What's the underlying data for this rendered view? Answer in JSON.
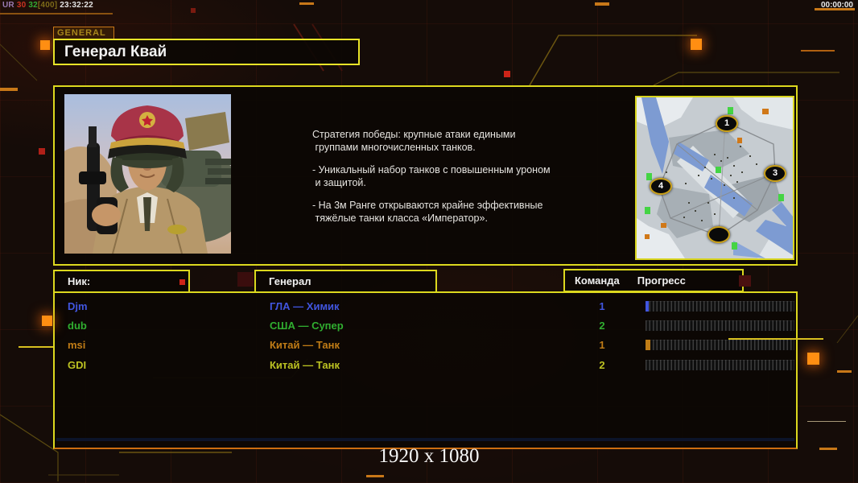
{
  "debug": {
    "tag": "UR",
    "val1": "30",
    "val2": "32",
    "val3": "[400]",
    "clock": "23:32:22"
  },
  "timer": "00:00:00",
  "header": {
    "tab": "GENERAL",
    "title": "Генерал Квай"
  },
  "strategy": {
    "lines": [
      "Стратегия победы: крупные атаки едиными",
      " группами многочисленных танков.",
      "- Уникальный набор танков с повышенным уроном",
      " и защитой.",
      "- На 3м Ранге открываются крайне эффективные",
      " тяжёлые танки класса «Император»."
    ]
  },
  "map": {
    "markers": [
      {
        "label": "1"
      },
      {
        "label": "3"
      },
      {
        "label": "4"
      },
      {
        "label": ""
      }
    ]
  },
  "table": {
    "headers": {
      "nick": "Ник:",
      "general": "Генерал",
      "team": "Команда",
      "progress": "Прогресс"
    }
  },
  "players": [
    {
      "nick": "Djm",
      "general": "ГЛА — Химик",
      "team": "1",
      "color": "#4156e0",
      "progress_pct": 2
    },
    {
      "nick": "dub",
      "general": "США — Супер",
      "team": "2",
      "color": "#30ae30",
      "progress_pct": 0
    },
    {
      "nick": "msi",
      "general": "Китай — Танк",
      "team": "1",
      "color": "#c07c16",
      "progress_pct": 3
    },
    {
      "nick": "GDI",
      "general": "Китай — Танк",
      "team": "2",
      "color": "#bcc222",
      "progress_pct": 0
    }
  ],
  "footer": {
    "resolution": "1920 x 1080"
  },
  "colors": {
    "debug_tag": "#9a7ab2",
    "debug_val1": "#cc3322",
    "debug_val2": "#33aa33",
    "debug_val3": "#7c6a18",
    "debug_clock": "#e2e2e2",
    "panel_border": "#dcd81e",
    "accent_orange": "#c87818"
  }
}
